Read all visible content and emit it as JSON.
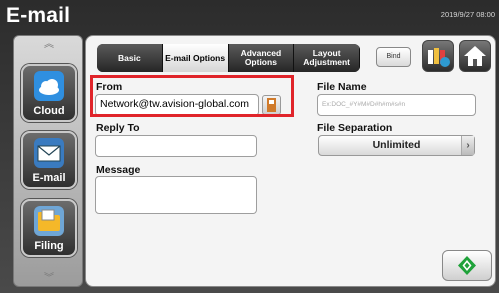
{
  "header": {
    "title": "E-mail",
    "timestamp": "2019/9/27 08:00"
  },
  "rail": {
    "items": [
      {
        "label": "Cloud",
        "icon": "cloud-icon"
      },
      {
        "label": "E-mail",
        "icon": "envelope-icon"
      },
      {
        "label": "Filing",
        "icon": "folder-icon"
      }
    ]
  },
  "tabs": [
    {
      "label": "Basic"
    },
    {
      "label": "E-mail Options",
      "active": true
    },
    {
      "label": "Advanced Options"
    },
    {
      "label": "Layout Adjustment"
    }
  ],
  "toolbar": {
    "bind_label": "Bind"
  },
  "form": {
    "from_label": "From",
    "from_value": "Network@tw.avision-global.com",
    "reply_to_label": "Reply To",
    "reply_to_value": "",
    "message_label": "Message",
    "message_value": "",
    "file_name_label": "File Name",
    "file_name_placeholder": "Ex:DOC_#Y#M#D#h#m#s#n",
    "file_separation_label": "File Separation",
    "file_separation_value": "Unlimited"
  },
  "colors": {
    "highlight": "#e0242a",
    "start_green": "#1fa23a"
  }
}
